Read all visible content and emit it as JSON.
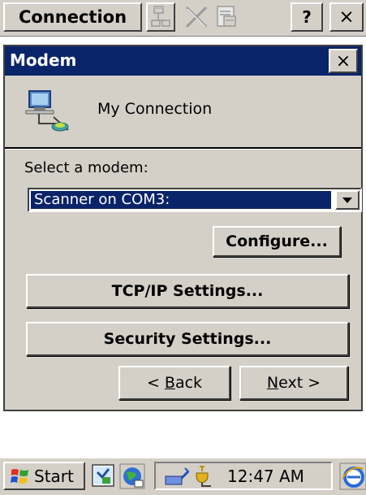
{
  "toolbar": {
    "title": "Connection",
    "help_label": "?",
    "close_label": "×"
  },
  "dialog": {
    "title": "Modem",
    "close_label": "×",
    "connection_name": "My Connection",
    "select_label": "Select a modem:",
    "modem_value": "Scanner on COM3:",
    "configure_label": "Configure...",
    "tcpip_label": "TCP/IP Settings...",
    "security_label": "Security Settings...",
    "back_prefix": "< ",
    "back_accel": "B",
    "back_rest": "ack",
    "next_accel": "N",
    "next_rest": "ext >"
  },
  "taskbar": {
    "start_label": "Start",
    "time": "12:47 AM"
  },
  "colors": {
    "titlebar": "#0a246a",
    "face": "#d4d0c8",
    "selection": "#0a246a"
  },
  "icons": [
    "network-icon",
    "disconnect-icon",
    "properties-icon",
    "connection-icon",
    "windows-flag-icon",
    "desktop-icon",
    "network-tray-icon",
    "ie-icon"
  ]
}
